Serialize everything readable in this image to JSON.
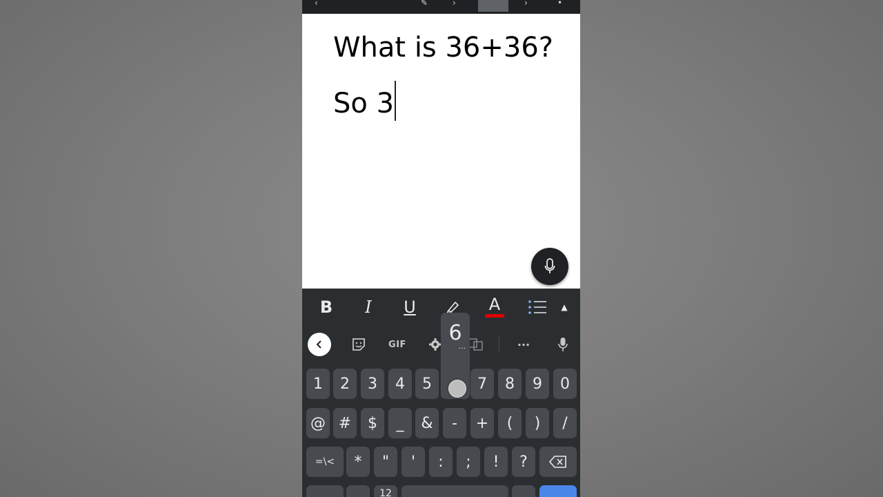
{
  "document": {
    "line1": "What is 36+36?",
    "line2": "So 3"
  },
  "format_bar": {
    "bold": "B",
    "italic": "I",
    "underline": "U",
    "text_color_label": "A",
    "text_color": "#e00000"
  },
  "keyboard": {
    "gif_label": "GIF",
    "more_label": "···",
    "popup": {
      "char": "6",
      "more": "…"
    },
    "row1": [
      "1",
      "2",
      "3",
      "4",
      "5",
      "6",
      "7",
      "8",
      "9",
      "0"
    ],
    "row2": [
      "@",
      "#",
      "$",
      "_",
      "&",
      "-",
      "+",
      "(",
      ")",
      "/"
    ],
    "row3": [
      "=\\<",
      "*",
      "\"",
      "'",
      ":",
      ";",
      "!",
      "?"
    ],
    "row4_partial": [
      "12"
    ],
    "accent_color": "#4a86e8"
  }
}
